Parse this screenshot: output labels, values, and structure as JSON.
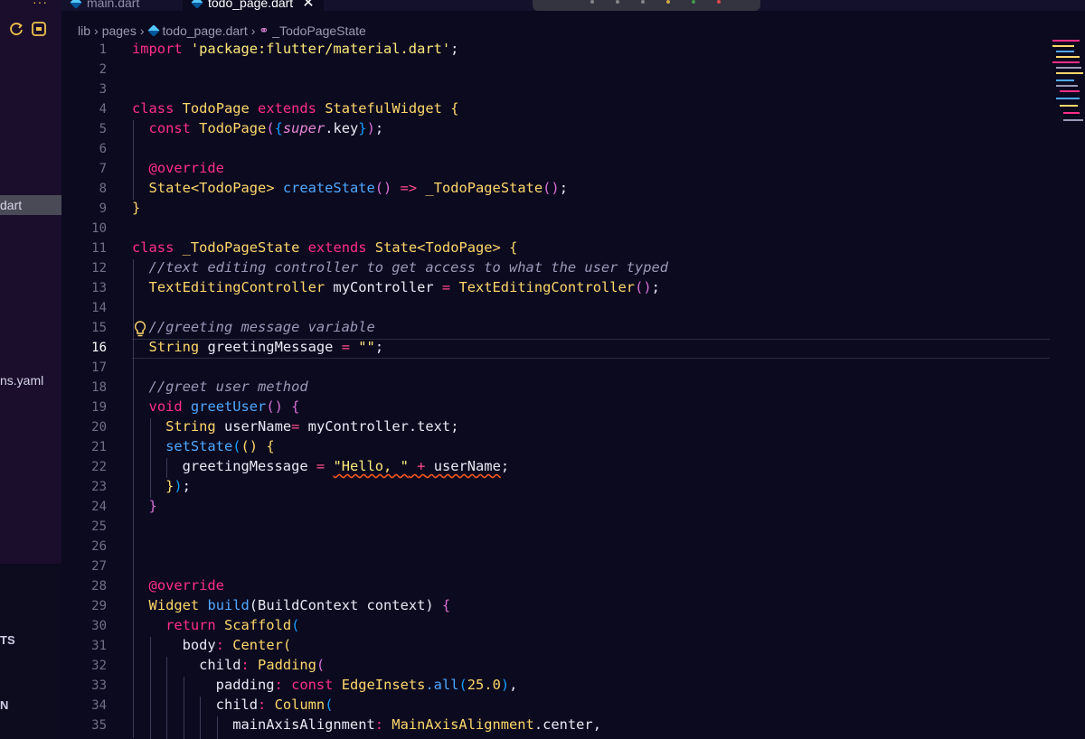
{
  "sidebar": {
    "items": [
      {
        "label": "dart",
        "selected": true
      },
      {
        "label": "ns.yaml",
        "selected": false
      }
    ],
    "sections": [
      "TS",
      "N"
    ]
  },
  "tabs": [
    {
      "label": "main.dart",
      "active": false
    },
    {
      "label": "todo_page.dart",
      "active": true
    }
  ],
  "breadcrumb": [
    "lib",
    "pages",
    "todo_page.dart",
    "_TodoPageState"
  ],
  "editor": {
    "current_line": 16,
    "lines": [
      {
        "n": "1"
      },
      {
        "n": "2"
      },
      {
        "n": "3"
      },
      {
        "n": "4"
      },
      {
        "n": "5"
      },
      {
        "n": "6"
      },
      {
        "n": "7"
      },
      {
        "n": "8"
      },
      {
        "n": "9"
      },
      {
        "n": "10"
      },
      {
        "n": "11"
      },
      {
        "n": "12"
      },
      {
        "n": "13"
      },
      {
        "n": "14"
      },
      {
        "n": "15"
      },
      {
        "n": "16"
      },
      {
        "n": "17"
      },
      {
        "n": "18"
      },
      {
        "n": "19"
      },
      {
        "n": "20"
      },
      {
        "n": "21"
      },
      {
        "n": "22"
      },
      {
        "n": "23"
      },
      {
        "n": "24"
      },
      {
        "n": "25"
      },
      {
        "n": "26"
      },
      {
        "n": "27"
      },
      {
        "n": "28"
      },
      {
        "n": "29"
      },
      {
        "n": "30"
      },
      {
        "n": "31"
      },
      {
        "n": "32"
      },
      {
        "n": "33"
      },
      {
        "n": "34"
      },
      {
        "n": "35"
      }
    ],
    "code": {
      "l1_kw": "import",
      "l1_str": "'package:flutter/material.dart'",
      "l1_end": ";",
      "l4_kw": "class",
      "l4_name": "TodoPage",
      "l4_ext": "extends",
      "l4_base": "StatefulWidget",
      "l4_br": "{",
      "l5_kw": "const",
      "l5_name": "TodoPage",
      "l5_p1": "(",
      "l5_b1": "{",
      "l5_super": "super",
      "l5_dot": ".key",
      "l5_b2": "}",
      "l5_p2": ")",
      "l5_end": ";",
      "l7": "@override",
      "l8_type": "State<TodoPage>",
      "l8_fn": "createState",
      "l8_par": "()",
      "l8_arrow": "=>",
      "l8_name": "_TodoPageState",
      "l8_par2": "()",
      "l8_end": ";",
      "l9": "}",
      "l11_kw": "class",
      "l11_name": "_TodoPageState",
      "l11_ext": "extends",
      "l11_base": "State<TodoPage>",
      "l11_br": "{",
      "l12": "//text editing controller to get access to what the user typed",
      "l13_type": "TextEditingController",
      "l13_var": "myController",
      "l13_eq": "=",
      "l13_val": "TextEditingController",
      "l13_par": "()",
      "l13_end": ";",
      "l15": "//greeting message variable",
      "l16_type": "String",
      "l16_var": "greetingMessage",
      "l16_eq": "=",
      "l16_str": "\"\"",
      "l16_end": ";",
      "l18": "//greet user method",
      "l19_kw": "void",
      "l19_fn": "greetUser",
      "l19_par": "()",
      "l19_br": "{",
      "l20_type": "String",
      "l20_var": "userName",
      "l20_eq": "=",
      "l20_val": "myController.text;",
      "l21_fn": "setState",
      "l21_p": "(",
      "l21_par": "()",
      "l21_br": "{",
      "l22_var": "greetingMessage",
      "l22_eq": "=",
      "l22_str": "\"Hello, \"",
      "l22_plus": "+",
      "l22_val": "userName",
      "l22_end": ";",
      "l23_br": "}",
      "l23_p": ")",
      "l23_end": ";",
      "l24": "}",
      "l28": "@override",
      "l29_type": "Widget",
      "l29_fn": "build",
      "l29_args": "(BuildContext context)",
      "l29_br": "{",
      "l30_kw": "return",
      "l30_name": "Scaffold",
      "l30_p": "(",
      "l31_param": "body",
      "l31_colon": ":",
      "l31_name": "Center",
      "l31_p": "(",
      "l32_param": "child",
      "l32_colon": ":",
      "l32_name": "Padding",
      "l32_p": "(",
      "l33_param": "padding",
      "l33_colon": ":",
      "l33_kw": "const",
      "l33_name": "EdgeInsets",
      "l33_fn": ".all",
      "l33_p1": "(",
      "l33_num": "25.0",
      "l33_p2": ")",
      "l33_end": ",",
      "l34_param": "child",
      "l34_colon": ":",
      "l34_name": "Column",
      "l34_p": "(",
      "l35_param": "mainAxisAlignment",
      "l35_colon": ":",
      "l35_name": "MainAxisAlignment",
      "l35_val": ".center,"
    }
  },
  "colors": {
    "background": "#0b0a1f",
    "keyword": "#ff2e88",
    "type": "#ffd76a",
    "function": "#4fa8ff",
    "comment": "#9a9ab8"
  },
  "icons": [
    "refresh-icon",
    "database-icon",
    "dart-file-icon",
    "class-symbol-icon",
    "lightbulb-icon",
    "close-icon"
  ]
}
